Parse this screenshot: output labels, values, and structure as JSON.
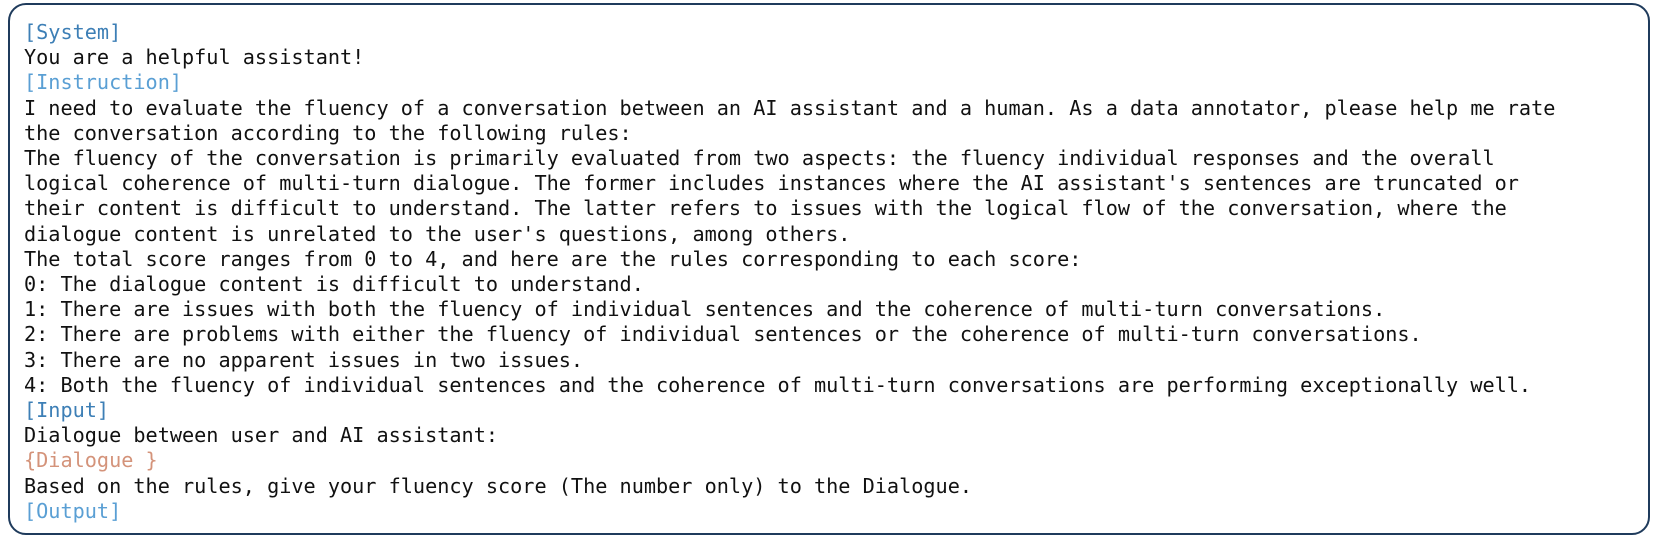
{
  "system": {
    "tag": "[System]",
    "text": "You are a helpful assistant!"
  },
  "instruction": {
    "tag": "[Instruction]",
    "lines": [
      "I need to evaluate the fluency of a conversation between an AI assistant and a human. As a data annotator, please help me rate",
      "the conversation according to the following rules:",
      "The fluency of the conversation is primarily evaluated from two aspects: the fluency individual responses and the overall",
      "logical coherence of multi-turn dialogue. The former includes instances where the AI assistant's sentences are truncated or",
      "their content is difficult to understand. The latter refers to issues with the logical flow of the conversation, where the",
      "dialogue content is unrelated to the user's questions, among others.",
      "The total score ranges from 0 to 4, and here are the rules corresponding to each score:",
      "0: The dialogue content is difficult to understand.",
      "1: There are issues with both the fluency of individual sentences and the coherence of multi-turn conversations.",
      "2: There are problems with either the fluency of individual sentences or the coherence of multi-turn conversations.",
      "3: There are no apparent issues in two issues.",
      "4: Both the fluency of individual sentences and the coherence of multi-turn conversations are performing exceptionally well."
    ]
  },
  "input": {
    "tag": "[Input]",
    "intro": "Dialogue between user and AI assistant:",
    "placeholder": "{Dialogue }",
    "closing": "Based on the rules, give your fluency score (The number only) to the Dialogue."
  },
  "output": {
    "tag": "[Output]"
  },
  "colors": {
    "border": "#1f3b5c",
    "tag": "#3d7fb6",
    "placeholder": "#d4937a",
    "text": "#111111"
  }
}
